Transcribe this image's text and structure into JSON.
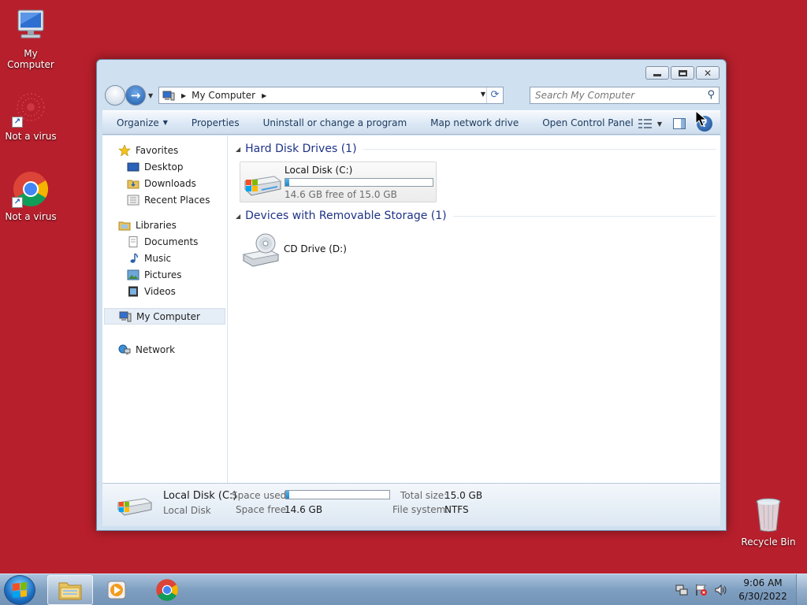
{
  "desktop": {
    "icons": [
      {
        "label": "My Computer"
      },
      {
        "label": "Not a virus"
      },
      {
        "label": "Not a virus"
      },
      {
        "label": "Recycle Bin"
      }
    ]
  },
  "window": {
    "address": {
      "location": "My Computer"
    },
    "search": {
      "placeholder": "Search My Computer"
    },
    "toolbar": {
      "organize": "Organize",
      "properties": "Properties",
      "uninstall": "Uninstall or change a program",
      "map_drive": "Map network drive",
      "control_panel": "Open Control Panel"
    },
    "nav": {
      "favorites": "Favorites",
      "desktop": "Desktop",
      "downloads": "Downloads",
      "recent": "Recent Places",
      "libraries": "Libraries",
      "documents": "Documents",
      "music": "Music",
      "pictures": "Pictures",
      "videos": "Videos",
      "computer": "My Computer",
      "network": "Network"
    },
    "groups": {
      "hdd_header": "Hard Disk Drives (1)",
      "removable_header": "Devices with Removable Storage (1)"
    },
    "drives": {
      "c": {
        "name": "Local Disk (C:)",
        "free_text": "14.6 GB free of 15.0 GB",
        "used_fraction": 0.027
      },
      "d": {
        "name": "CD Drive (D:)"
      }
    },
    "details": {
      "name": "Local Disk (C:)",
      "type": "Local Disk",
      "space_used_label": "Space used:",
      "space_free_label": "Space free:",
      "space_free": "14.6 GB",
      "total_size_label": "Total size:",
      "total_size": "15.0 GB",
      "fs_label": "File system:",
      "fs": "NTFS",
      "used_fraction": 0.027
    }
  },
  "taskbar": {
    "clock": {
      "time": "9:06 AM",
      "date": "6/30/2022"
    }
  },
  "colors": {
    "desktop_bg": "#b81f2c",
    "progress_fill": "#1f84c9",
    "group_header": "#1e3287"
  }
}
